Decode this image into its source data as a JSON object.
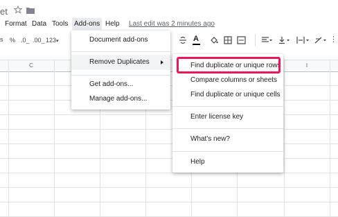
{
  "title": {
    "fragment": "et"
  },
  "menubar": {
    "items": [
      "Format",
      "Data",
      "Tools",
      "Add-ons",
      "Help"
    ],
    "active": "Add-ons",
    "last_edit": "Last edit was 2 minutes ago"
  },
  "toolbar": {
    "percent": "%",
    "decimal_less": ".0_",
    "decimal_more": ".00_",
    "format_more": "123",
    "text_color_letter": "A"
  },
  "columns": [
    "C",
    "I"
  ],
  "addons_menu": {
    "items": [
      {
        "label": "Document add-ons"
      },
      {
        "label": "Remove Duplicates",
        "has_submenu": true
      },
      {
        "label": "Get add-ons..."
      },
      {
        "label": "Manage add-ons..."
      }
    ]
  },
  "submenu": {
    "items": [
      {
        "label": "Find duplicate or unique rows"
      },
      {
        "label": "Compare columns or sheets"
      },
      {
        "label": "Find duplicate or unique cells"
      },
      {
        "label": "Enter license key"
      },
      {
        "label": "What's new?"
      },
      {
        "label": "Help"
      }
    ]
  },
  "colors": {
    "highlight_border": "#e8195a",
    "active_menu_bg": "#e8eaed"
  }
}
